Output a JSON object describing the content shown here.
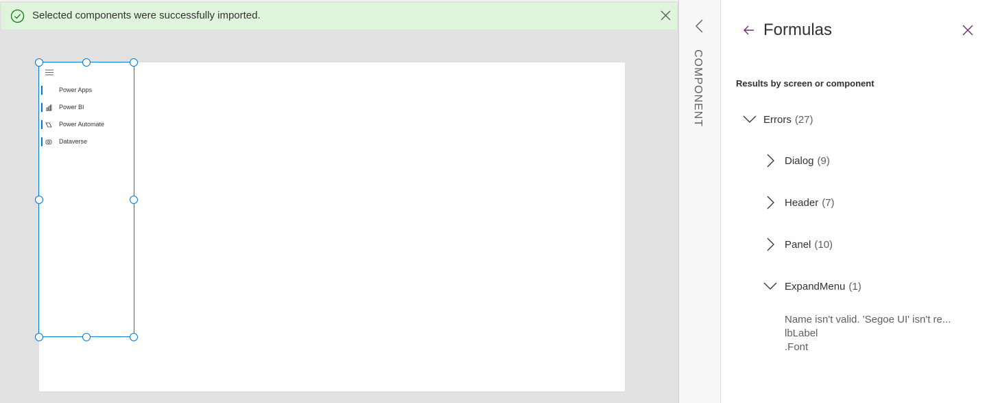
{
  "banner": {
    "message": "Selected components were successfully imported.",
    "icon": "checkmark-circle-icon",
    "close_icon": "close-icon",
    "color": "#dff6dd"
  },
  "component_menu": {
    "hamburger_icon": "hamburger-icon",
    "items": [
      {
        "label": "Power Apps",
        "icon": "none"
      },
      {
        "label": "Power BI",
        "icon": "chart-icon"
      },
      {
        "label": "Power Automate",
        "icon": "flow-icon"
      },
      {
        "label": "Dataverse",
        "icon": "database-icon"
      }
    ],
    "accent": "#0078d4"
  },
  "strip": {
    "label": "COMPONENT",
    "collapse_icon": "chevron-left-icon"
  },
  "panel": {
    "title": "Formulas",
    "back_icon": "arrow-left-icon",
    "close_icon": "close-icon",
    "subtitle": "Results by screen or component",
    "tree": [
      {
        "label": "Errors",
        "count": "(27)",
        "expanded": true
      },
      {
        "label": "Dialog",
        "count": "(9)",
        "expanded": false
      },
      {
        "label": "Header",
        "count": "(7)",
        "expanded": false
      },
      {
        "label": "Panel",
        "count": "(10)",
        "expanded": false
      },
      {
        "label": "ExpandMenu",
        "count": "(1)",
        "expanded": true
      }
    ],
    "error_detail": {
      "message": "Name isn't valid. 'Segoe UI' isn't re...",
      "control": "lbLabel",
      "property": ".Font"
    },
    "accent": "#742774"
  }
}
